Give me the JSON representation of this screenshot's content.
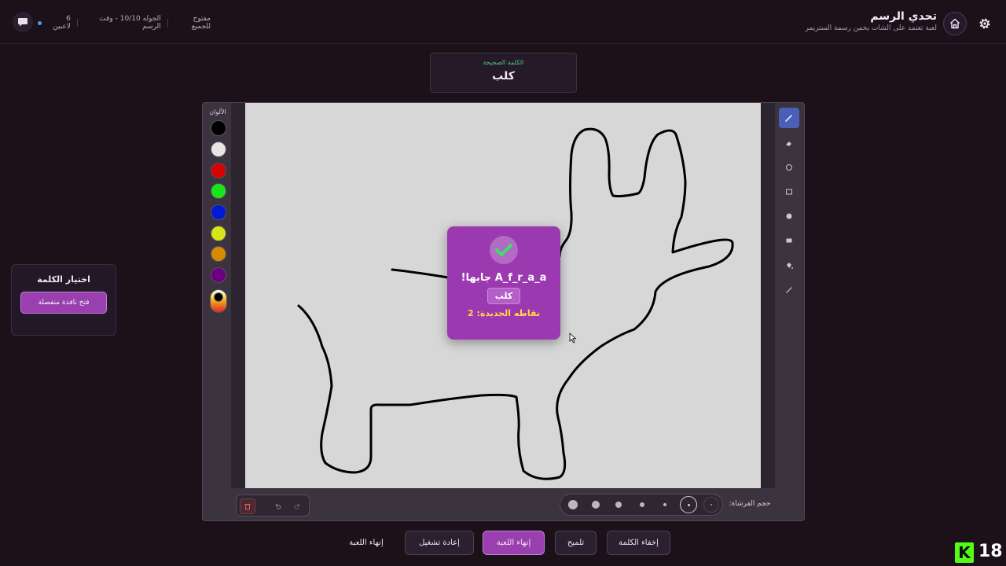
{
  "header": {
    "title": "تحدي الرسم",
    "subtitle": "لعبة تعتمد على الشات يخمن رسمة الستريمر",
    "players": "6 لاعبين",
    "round": "الجوله 10/10 - وقت الرسم",
    "mode": "مفتوح للجميع"
  },
  "word_box": {
    "label": "الكلمة الصحيحة",
    "word": "كلب"
  },
  "palette": {
    "label": "الألوان",
    "colors": [
      "#000000",
      "#e6e6e6",
      "#d90000",
      "#19e619",
      "#0019d6",
      "#d6e619",
      "#d68a00",
      "#6b0080"
    ]
  },
  "tools": [
    "pencil-icon",
    "eraser-icon",
    "circle-outline-icon",
    "rectangle-outline-icon",
    "circle-fill-icon",
    "rectangle-fill-icon",
    "fill-bucket-icon",
    "line-icon"
  ],
  "brush": {
    "label": "حجم الفرشاة:",
    "selected_index": 5
  },
  "popup": {
    "winner": "A_f_r_a_a جابها!",
    "word": "كلب",
    "points": "نقاطه الجديدة: 2"
  },
  "pick_widget": {
    "title": "اختيار الكلمة",
    "button": "فتح نافذة منفصلة"
  },
  "buttons": {
    "hide_word": "إخفاء الكلمة",
    "hint": "تلميح",
    "end_game_primary": "إنهاء اللعبة",
    "restart": "إعادة تشغيل",
    "end_game": "إنهاء اللعبة"
  },
  "corner": {
    "logo_letter": "K",
    "number": "18"
  },
  "colors": {
    "accent": "#9b39b0",
    "background": "#1c1119",
    "canvas": "#d7d7d7",
    "active_tool": "#4b5fb8"
  }
}
